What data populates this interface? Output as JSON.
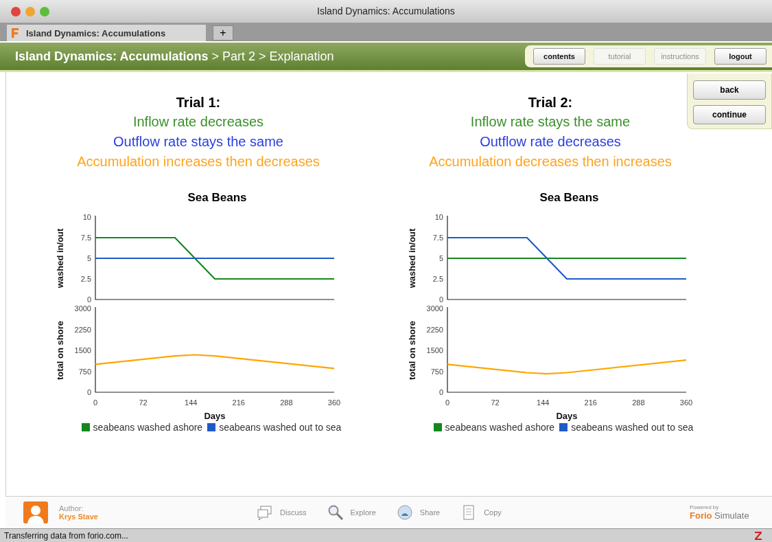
{
  "browser": {
    "window_title": "Island Dynamics: Accumulations",
    "tab": {
      "title": "Island Dynamics: Accumulations",
      "selected": true
    },
    "new_tab_button": "+"
  },
  "header": {
    "breadcrumb": "**Island Dynamics: Accumulations** > Part 2 > Explanation",
    "buttons": [
      {
        "label": "contents",
        "disabled": false
      },
      {
        "label": "tutorial",
        "disabled": true
      },
      {
        "label": "instructions",
        "disabled": true
      },
      {
        "label": "logout",
        "disabled": false
      }
    ]
  },
  "side_buttons": [
    "back",
    "continue"
  ],
  "trials": [
    {
      "title": "Trial 1:",
      "statements": [
        {
          "text": "Inflow rate decreases",
          "color": "#3b8f2a"
        },
        {
          "text": "Outflow rate stays the same",
          "color": "#2a3ee0"
        },
        {
          "text": "Accumulation increases then decreases",
          "color": "#ffa31a"
        }
      ],
      "flow_chart": {
        "chart_data": {
          "type": "line",
          "title": "Sea Beans",
          "ylabel": "washed in/out",
          "x": [
            0,
            120,
            150,
            180,
            360
          ],
          "series": [
            {
              "name": "seabeans washed ashore",
              "color": "#14881c",
              "values": [
                7.5,
                7.5,
                5,
                2.5,
                2.5
              ]
            },
            {
              "name": "seabeans washed out to sea",
              "color": "#1e5bc6",
              "values": [
                5,
                5,
                5,
                5,
                5
              ]
            }
          ],
          "xlim": [
            0,
            360
          ],
          "ylim": [
            0,
            10
          ],
          "yticks": [
            0,
            2.5,
            5,
            7.5,
            10
          ]
        }
      },
      "stock_chart": {
        "chart_data": {
          "type": "line",
          "xlabel": "Days",
          "ylabel": "total on shore",
          "x": [
            0,
            120,
            150,
            180,
            360
          ],
          "series": [
            {
              "color": "#ffa500",
              "values": [
                1000,
                1300,
                1340,
                1300,
                850
              ]
            }
          ],
          "xlim": [
            0,
            360
          ],
          "ylim": [
            0,
            3000
          ],
          "xticks": [
            0,
            72,
            144,
            216,
            288,
            360
          ],
          "yticks": [
            0,
            750,
            1500,
            2250,
            3000
          ]
        }
      }
    },
    {
      "title": "Trial 2:",
      "statements": [
        {
          "text": "Inflow rate stays the same",
          "color": "#3b8f2a"
        },
        {
          "text": "Outflow rate decreases",
          "color": "#2a3ee0"
        },
        {
          "text": "Accumulation decreases then increases",
          "color": "#ffa31a"
        }
      ],
      "flow_chart": {
        "chart_data": {
          "type": "line",
          "title": "Sea Beans",
          "ylabel": "washed in/out",
          "x": [
            0,
            120,
            150,
            180,
            360
          ],
          "series": [
            {
              "name": "seabeans washed ashore",
              "color": "#14881c",
              "values": [
                5,
                5,
                5,
                5,
                5
              ]
            },
            {
              "name": "seabeans washed out to sea",
              "color": "#1e5bc6",
              "values": [
                7.5,
                7.5,
                5,
                2.5,
                2.5
              ]
            }
          ],
          "xlim": [
            0,
            360
          ],
          "ylim": [
            0,
            10
          ],
          "yticks": [
            0,
            2.5,
            5,
            7.5,
            10
          ]
        }
      },
      "stock_chart": {
        "chart_data": {
          "type": "line",
          "xlabel": "Days",
          "ylabel": "total on shore",
          "x": [
            0,
            120,
            150,
            180,
            360
          ],
          "series": [
            {
              "color": "#ffa500",
              "values": [
                1000,
                700,
                660,
                700,
                1150
              ]
            }
          ],
          "xlim": [
            0,
            360
          ],
          "ylim": [
            0,
            3000
          ],
          "xticks": [
            0,
            72,
            144,
            216,
            288,
            360
          ],
          "yticks": [
            0,
            750,
            1500,
            2250,
            3000
          ]
        }
      }
    }
  ],
  "footer": {
    "author_label": "Author:",
    "author_name": "Krys Stave",
    "links": [
      {
        "kind": "discuss",
        "label": "Discuss"
      },
      {
        "kind": "explore",
        "label": "Explore"
      },
      {
        "kind": "share",
        "label": "Share"
      },
      {
        "kind": "copy",
        "label": "Copy"
      }
    ],
    "powered_by": "Powered by",
    "brand_first": "Forio",
    "brand_second": "Simulate"
  },
  "status_bar": "Transferring data from forio.com..."
}
